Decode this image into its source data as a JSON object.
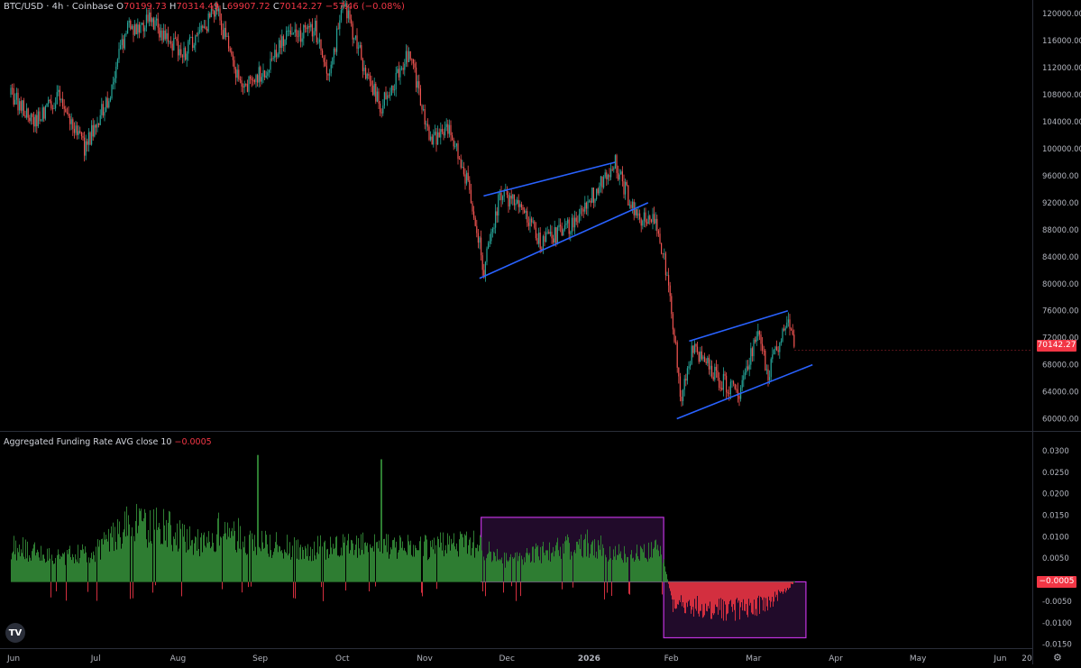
{
  "header": {
    "symbol": "BTC/USD · 4h · Coinbase",
    "o_label": "O",
    "o_value": "70199.73",
    "h_label": "H",
    "h_value": "70314.49",
    "l_label": "L",
    "l_value": "69907.72",
    "c_label": "C",
    "c_value": "70142.27",
    "change": "−57.46 (−0.08%)"
  },
  "indicator": {
    "title": "Aggregated Funding Rate AVG close 10",
    "value": "−0.0005"
  },
  "last_price_label": "70142.27",
  "last_funding_label": "−0.0005",
  "colors": {
    "up": "#26a69a",
    "down": "#ef5350",
    "trendline": "#2962ff",
    "funding_pos": "#2e7d32",
    "funding_neg": "#d32f3f",
    "box_stroke": "#c133e0",
    "box_fill": "rgba(120,40,150,0.28)"
  },
  "chart_data": [
    {
      "type": "candlestick",
      "symbol": "BTC/USD",
      "timeframe": "4h",
      "exchange": "Coinbase",
      "ylim": [
        59000,
        121500
      ],
      "y_ticks": [
        "120000.00",
        "116000.00",
        "112000.00",
        "108000.00",
        "104000.00",
        "100000.00",
        "96000.00",
        "92000.00",
        "88000.00",
        "84000.00",
        "80000.00",
        "76000.00",
        "72000.00",
        "68000.00",
        "64000.00",
        "60000.00"
      ],
      "x_ticks": [
        "Jun",
        "Jul",
        "Aug",
        "Sep",
        "Oct",
        "Nov",
        "Dec",
        "2026",
        "Feb",
        "Mar",
        "Apr",
        "May",
        "Jun",
        "20"
      ],
      "approx_path": [
        {
          "t": 0.0,
          "price": 108000
        },
        {
          "t": 0.3,
          "price": 104000
        },
        {
          "t": 0.6,
          "price": 108000
        },
        {
          "t": 0.9,
          "price": 100000
        },
        {
          "t": 1.2,
          "price": 108000
        },
        {
          "t": 1.4,
          "price": 117500
        },
        {
          "t": 1.7,
          "price": 119000
        },
        {
          "t": 2.1,
          "price": 114000
        },
        {
          "t": 2.5,
          "price": 120500
        },
        {
          "t": 2.8,
          "price": 109000
        },
        {
          "t": 3.1,
          "price": 111500
        },
        {
          "t": 3.3,
          "price": 116000
        },
        {
          "t": 3.7,
          "price": 118000
        },
        {
          "t": 3.85,
          "price": 110000
        },
        {
          "t": 4.05,
          "price": 121500
        },
        {
          "t": 4.3,
          "price": 112000
        },
        {
          "t": 4.5,
          "price": 106000
        },
        {
          "t": 4.85,
          "price": 114500
        },
        {
          "t": 5.1,
          "price": 101000
        },
        {
          "t": 5.35,
          "price": 103000
        },
        {
          "t": 5.6,
          "price": 93000
        },
        {
          "t": 5.75,
          "price": 82000
        },
        {
          "t": 5.95,
          "price": 93000
        },
        {
          "t": 6.2,
          "price": 91500
        },
        {
          "t": 6.45,
          "price": 86000
        },
        {
          "t": 6.75,
          "price": 88000
        },
        {
          "t": 7.1,
          "price": 93500
        },
        {
          "t": 7.35,
          "price": 97800
        },
        {
          "t": 7.6,
          "price": 90000
        },
        {
          "t": 7.85,
          "price": 89500
        },
        {
          "t": 8.0,
          "price": 80000
        },
        {
          "t": 8.15,
          "price": 63000
        },
        {
          "t": 8.3,
          "price": 70500
        },
        {
          "t": 8.6,
          "price": 66000
        },
        {
          "t": 8.85,
          "price": 63500
        },
        {
          "t": 9.1,
          "price": 73500
        },
        {
          "t": 9.2,
          "price": 66500
        },
        {
          "t": 9.45,
          "price": 75000
        },
        {
          "t": 9.53,
          "price": 70142
        }
      ],
      "last_price": 70142.27
    },
    {
      "type": "bar",
      "title": "Aggregated Funding Rate AVG close 10",
      "ylim": [
        -0.0155,
        0.0325
      ],
      "y_ticks": [
        "0.0300",
        "0.0250",
        "0.0200",
        "0.0150",
        "0.0100",
        "0.0050",
        "-0.0005",
        "-0.0050",
        "-0.0100",
        "-0.0150"
      ],
      "approx_profile": [
        {
          "t": 0.0,
          "value": 0.0085
        },
        {
          "t": 0.5,
          "value": 0.006
        },
        {
          "t": 1.0,
          "value": 0.0065
        },
        {
          "t": 1.45,
          "value": 0.014
        },
        {
          "t": 1.9,
          "value": 0.0125
        },
        {
          "t": 2.3,
          "value": 0.009
        },
        {
          "t": 2.55,
          "value": 0.0125
        },
        {
          "t": 3.0,
          "value": 0.0095
        },
        {
          "t": 3.5,
          "value": 0.0075
        },
        {
          "t": 4.0,
          "value": 0.0085
        },
        {
          "t": 4.5,
          "value": 0.0085
        },
        {
          "t": 5.0,
          "value": 0.008
        },
        {
          "t": 5.6,
          "value": 0.0095
        },
        {
          "t": 6.0,
          "value": 0.005
        },
        {
          "t": 6.6,
          "value": 0.0075
        },
        {
          "t": 7.0,
          "value": 0.009
        },
        {
          "t": 7.5,
          "value": 0.0065
        },
        {
          "t": 7.9,
          "value": 0.0075
        },
        {
          "t": 8.05,
          "value": -0.006
        },
        {
          "t": 8.4,
          "value": -0.007
        },
        {
          "t": 8.8,
          "value": -0.0075
        },
        {
          "t": 9.2,
          "value": -0.006
        },
        {
          "t": 9.53,
          "value": -0.0005
        }
      ],
      "spikes": [
        {
          "t": 3.0,
          "value": 0.029
        },
        {
          "t": 4.5,
          "value": 0.028
        }
      ],
      "last_value": -0.0005
    }
  ],
  "drawings": {
    "channels": [
      {
        "name": "Nov–Jan rising channel",
        "upper": [
          [
            5.75,
            93000
          ],
          [
            7.35,
            98000
          ]
        ],
        "lower": [
          [
            5.7,
            80800
          ],
          [
            7.75,
            92000
          ]
        ]
      },
      {
        "name": "Feb–Mar rising channel",
        "upper": [
          [
            8.25,
            71500
          ],
          [
            9.45,
            76000
          ]
        ],
        "lower": [
          [
            8.1,
            60000
          ],
          [
            9.75,
            68000
          ]
        ]
      }
    ],
    "boxes": [
      {
        "name": "Dec–Jan funding box",
        "t_range": [
          5.72,
          7.94
        ],
        "value_range": [
          -0.0005,
          0.0145
        ]
      },
      {
        "name": "Feb–Mar funding box",
        "t_range": [
          7.94,
          9.67
        ],
        "value_range": [
          -0.0135,
          -0.0005
        ]
      }
    ]
  }
}
